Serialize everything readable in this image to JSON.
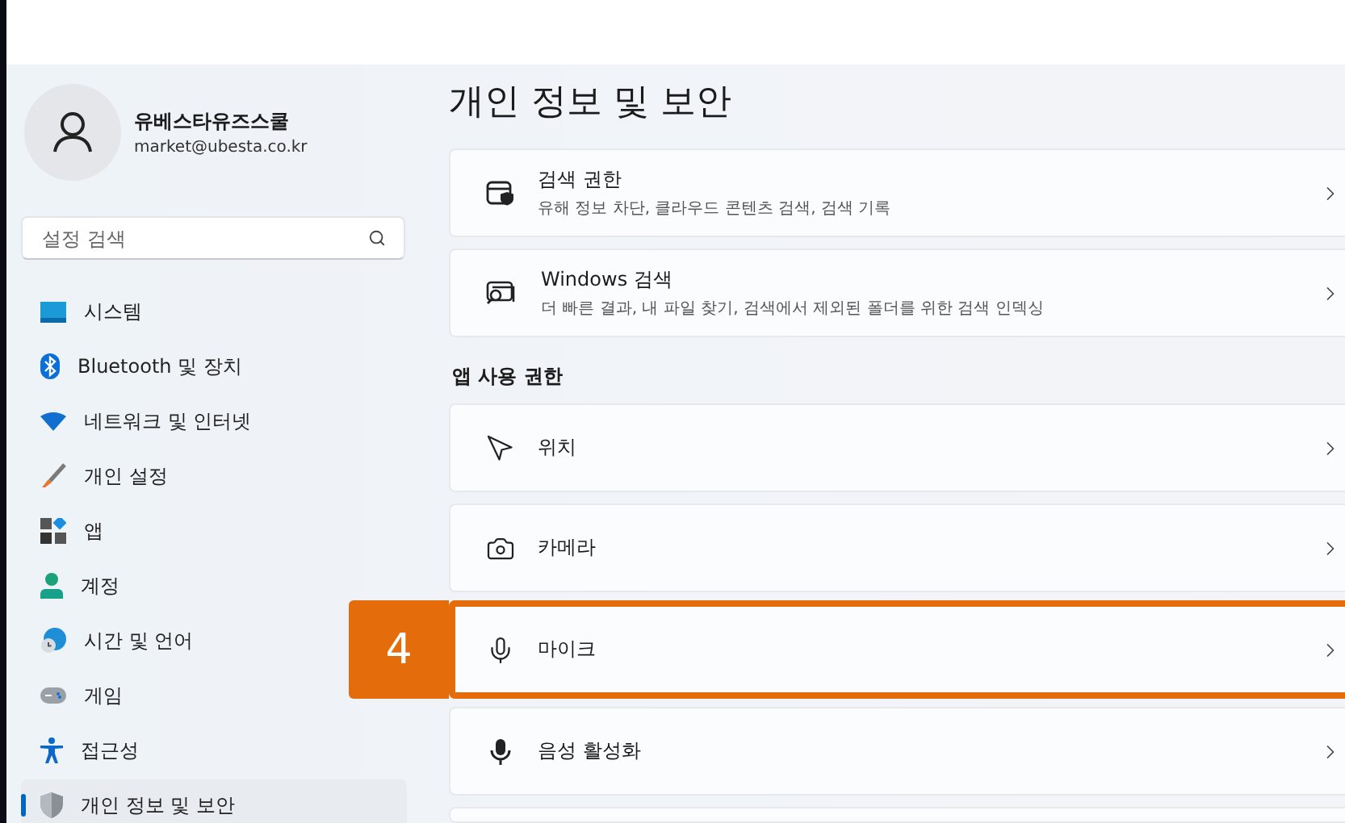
{
  "account": {
    "name": "유베스타유즈스쿨",
    "email": "market@ubesta.co.kr"
  },
  "search": {
    "placeholder": "설정 검색"
  },
  "nav": [
    {
      "label": "시스템",
      "selected": false
    },
    {
      "label": "Bluetooth 및 장치",
      "selected": false
    },
    {
      "label": "네트워크 및 인터넷",
      "selected": false
    },
    {
      "label": "개인 설정",
      "selected": false
    },
    {
      "label": "앱",
      "selected": false
    },
    {
      "label": "계정",
      "selected": false
    },
    {
      "label": "시간 및 언어",
      "selected": false
    },
    {
      "label": "게임",
      "selected": false
    },
    {
      "label": "접근성",
      "selected": false
    },
    {
      "label": "개인 정보 및 보안",
      "selected": true
    }
  ],
  "page_title": "개인 정보 및 보안",
  "top_cards": [
    {
      "title": "검색 권한",
      "subtitle": "유해 정보 차단, 클라우드 콘텐츠 검색, 검색 기록"
    },
    {
      "title": "Windows 검색",
      "subtitle": "더 빠른 결과, 내 파일 찾기, 검색에서 제외된 폴더를 위한 검색 인덱싱"
    }
  ],
  "app_permissions": {
    "heading": "앱 사용 권한",
    "items": [
      {
        "title": "위치"
      },
      {
        "title": "카메라"
      },
      {
        "title": "마이크",
        "callout": "4"
      },
      {
        "title": "음성 활성화"
      }
    ]
  }
}
